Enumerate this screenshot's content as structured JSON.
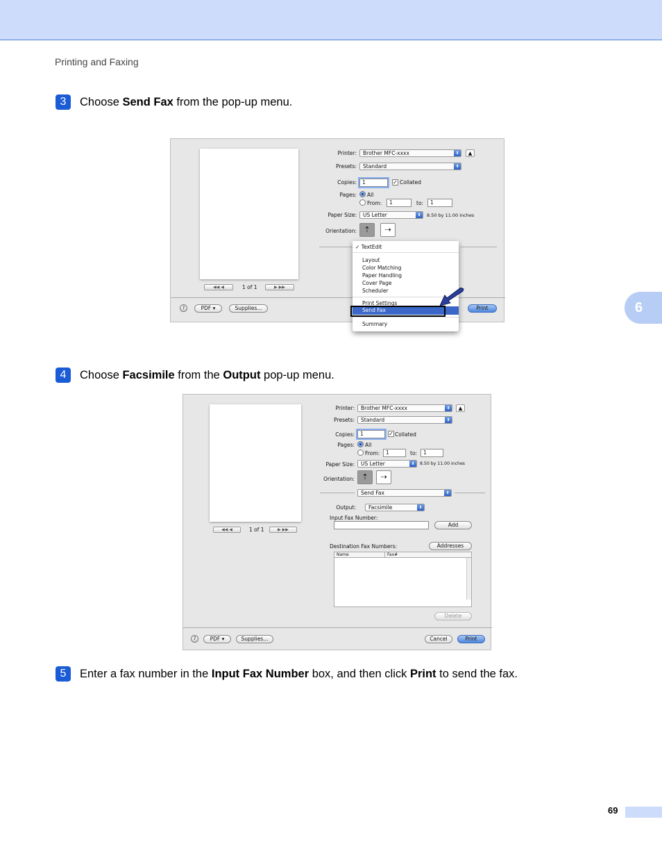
{
  "header": {
    "section": "Printing and Faxing",
    "chapter": "6"
  },
  "steps": [
    {
      "num": "3",
      "parts": [
        "Choose ",
        "Send Fax",
        " from the pop-up menu."
      ]
    },
    {
      "num": "4",
      "parts": [
        "Choose ",
        "Facsimile",
        " from the ",
        "Output",
        " pop-up menu."
      ]
    },
    {
      "num": "5",
      "parts": [
        "Enter a fax number in the ",
        "Input Fax Number",
        " box, and then click ",
        "Print",
        " to send the fax."
      ]
    }
  ],
  "dialog1": {
    "printer_label": "Printer:",
    "printer_value": "Brother MFC-xxxx",
    "presets_label": "Presets:",
    "presets_value": "Standard",
    "copies_label": "Copies:",
    "copies_value": "1",
    "collated": "Collated",
    "pages_label": "Pages:",
    "pages_all": "All",
    "pages_from": "From:",
    "from_value": "1",
    "to_label": "to:",
    "to_value": "1",
    "paper_label": "Paper Size:",
    "paper_value": "US Letter",
    "paper_dims": "8.50 by 11.00 inches",
    "orientation_label": "Orientation:",
    "page_of": "1 of 1",
    "pdf": "PDF ▾",
    "supplies": "Supplies...",
    "print": "Print",
    "menu": {
      "checked": "✓ TextEdit",
      "items": [
        "Layout",
        "Color Matching",
        "Paper Handling",
        "Cover Page",
        "Scheduler"
      ],
      "print_settings": "Print Settings",
      "selected": "Send Fax",
      "summary": "Summary"
    }
  },
  "dialog2": {
    "printer_label": "Printer:",
    "printer_value": "Brother MFC-xxxx",
    "presets_label": "Presets:",
    "presets_value": "Standard",
    "copies_label": "Copies:",
    "copies_value": "1",
    "collated": "Collated",
    "pages_label": "Pages:",
    "pages_all": "All",
    "pages_from": "From:",
    "from_value": "1",
    "to_label": "to:",
    "to_value": "1",
    "paper_label": "Paper Size:",
    "paper_value": "US Letter",
    "paper_dims": "8.50 by 11.00 inches",
    "orientation_label": "Orientation:",
    "pane_value": "Send Fax",
    "output_label": "Output:",
    "output_value": "Facsimile",
    "input_fax_label": "Input Fax Number:",
    "add": "Add",
    "dest_label": "Destination Fax Numbers:",
    "addresses": "Addresses",
    "col_name": "Name",
    "col_fax": "Fax#",
    "delete": "Delete",
    "page_of": "1 of 1",
    "pdf": "PDF ▾",
    "supplies": "Supplies...",
    "cancel": "Cancel",
    "print": "Print"
  },
  "footer": {
    "page_number": "69"
  }
}
